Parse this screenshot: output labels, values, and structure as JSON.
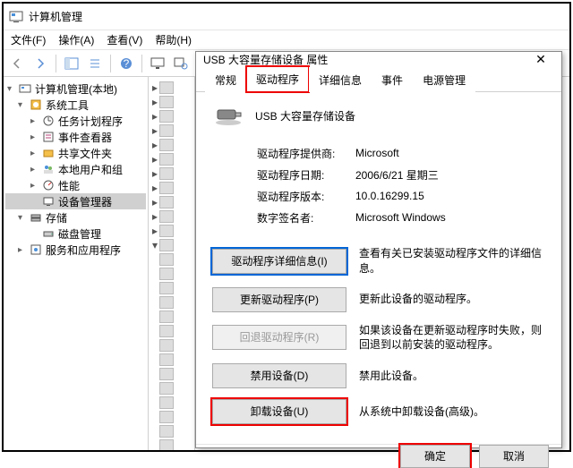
{
  "window": {
    "title": "计算机管理"
  },
  "menu": {
    "file": "文件(F)",
    "action": "操作(A)",
    "view": "查看(V)",
    "help": "帮助(H)"
  },
  "tree": {
    "root": "计算机管理(本地)",
    "systools": "系统工具",
    "task": "任务计划程序",
    "event": "事件查看器",
    "shared": "共享文件夹",
    "users": "本地用户和组",
    "perf": "性能",
    "devmgr": "设备管理器",
    "storage": "存储",
    "disk": "磁盘管理",
    "services": "服务和应用程序"
  },
  "dialog": {
    "title": "USB 大容量存储设备 属性",
    "tabs": {
      "general": "常规",
      "driver": "驱动程序",
      "details": "详细信息",
      "events": "事件",
      "power": "电源管理"
    },
    "device_name": "USB 大容量存储设备",
    "props": {
      "provider_k": "驱动程序提供商:",
      "provider_v": "Microsoft",
      "date_k": "驱动程序日期:",
      "date_v": "2006/6/21 星期三",
      "version_k": "驱动程序版本:",
      "version_v": "10.0.16299.15",
      "signer_k": "数字签名者:",
      "signer_v": "Microsoft Windows"
    },
    "actions": {
      "details_btn": "驱动程序详细信息(I)",
      "details_desc": "查看有关已安装驱动程序文件的详细信息。",
      "update_btn": "更新驱动程序(P)",
      "update_desc": "更新此设备的驱动程序。",
      "rollback_btn": "回退驱动程序(R)",
      "rollback_desc": "如果该设备在更新驱动程序时失败，则回退到以前安装的驱动程序。",
      "disable_btn": "禁用设备(D)",
      "disable_desc": "禁用此设备。",
      "uninstall_btn": "卸载设备(U)",
      "uninstall_desc": "从系统中卸载设备(高级)。"
    },
    "ok": "确定",
    "cancel": "取消"
  }
}
